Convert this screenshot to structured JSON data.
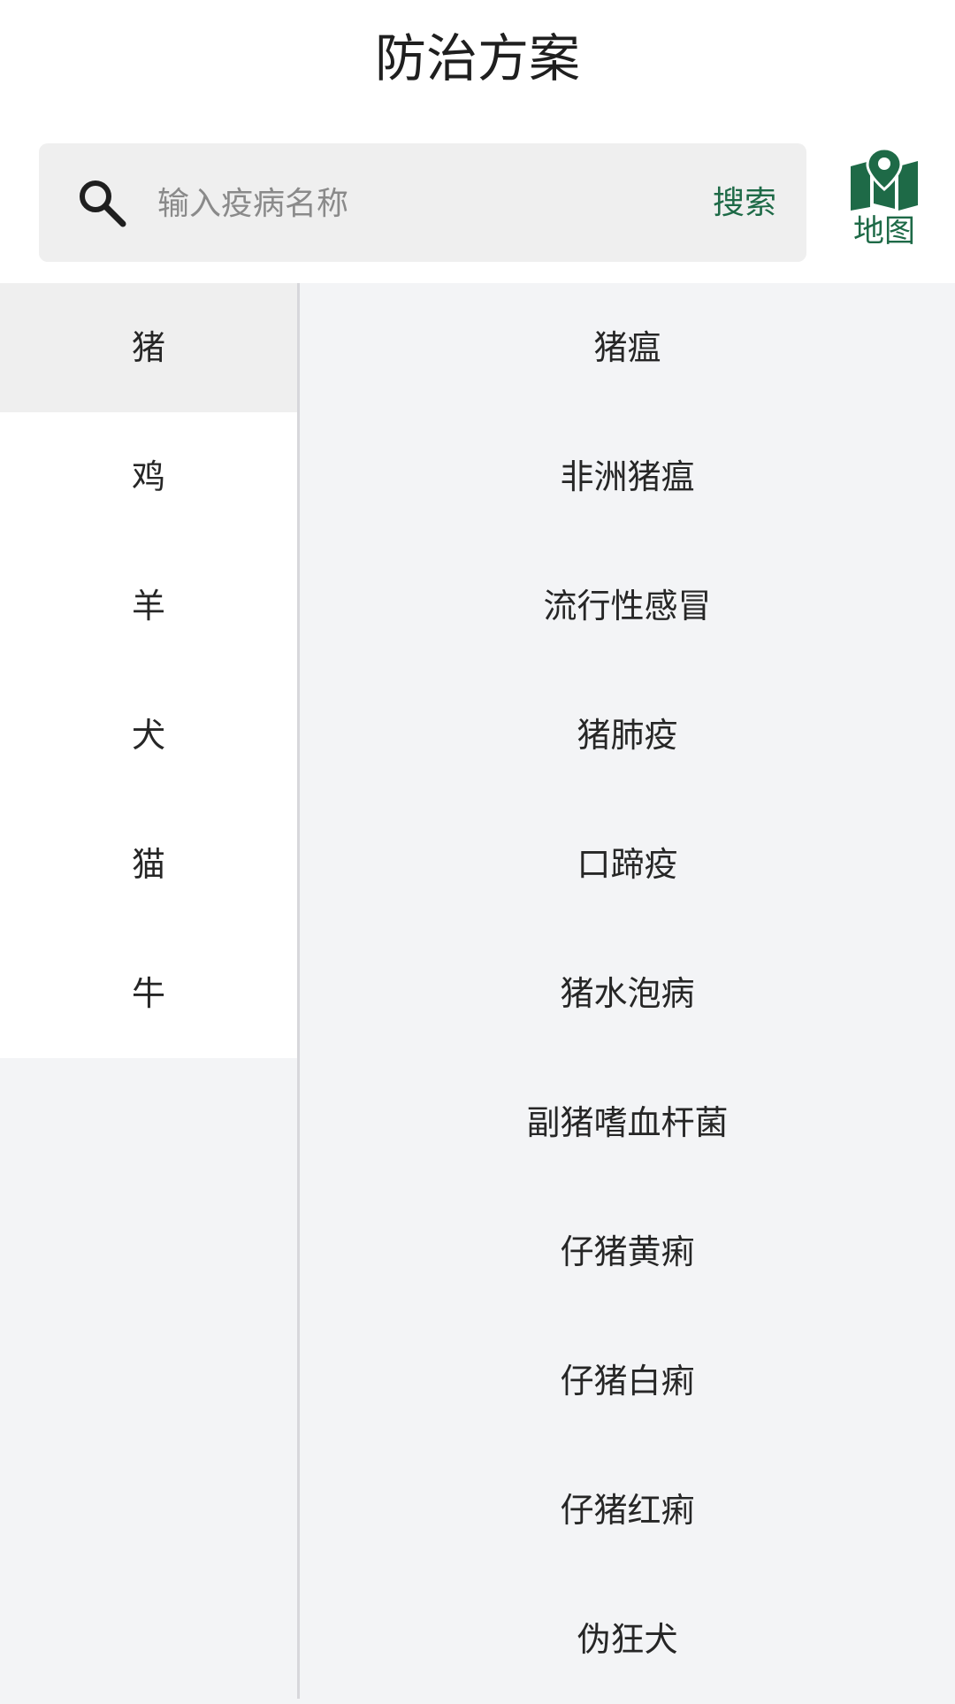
{
  "header": {
    "title": "防治方案"
  },
  "search": {
    "placeholder": "输入疫病名称",
    "value": "",
    "button_label": "搜索",
    "icon": "search-icon"
  },
  "map_button": {
    "label": "地图",
    "icon": "map-pin-icon"
  },
  "colors": {
    "accent": "#1e6a47",
    "panel_bg": "#f3f4f6",
    "active_bg": "#efefef"
  },
  "categories": [
    {
      "label": "猪",
      "active": true
    },
    {
      "label": "鸡",
      "active": false
    },
    {
      "label": "羊",
      "active": false
    },
    {
      "label": "犬",
      "active": false
    },
    {
      "label": "猫",
      "active": false
    },
    {
      "label": "牛",
      "active": false
    }
  ],
  "diseases": [
    {
      "label": "猪瘟"
    },
    {
      "label": "非洲猪瘟"
    },
    {
      "label": "流行性感冒"
    },
    {
      "label": "猪肺疫"
    },
    {
      "label": "口蹄疫"
    },
    {
      "label": "猪水泡病"
    },
    {
      "label": "副猪嗜血杆菌"
    },
    {
      "label": "仔猪黄痢"
    },
    {
      "label": "仔猪白痢"
    },
    {
      "label": "仔猪红痢"
    },
    {
      "label": "伪狂犬"
    }
  ]
}
